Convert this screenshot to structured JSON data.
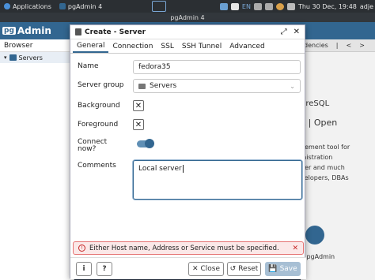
{
  "sysbar": {
    "applications": "Applications",
    "task": "pgAdmin 4",
    "lang": "EN",
    "clock": "Thu 30 Dec, 19:48",
    "user": "adje"
  },
  "window": {
    "title": "pgAdmin 4"
  },
  "app": {
    "logo_pg": "pg",
    "logo_name": "Admin"
  },
  "browser": {
    "header": "Browser",
    "tree_item": "Servers"
  },
  "background": {
    "tabs": [
      "dencies",
      "|",
      "<",
      ">"
    ],
    "lines": [
      "greSQL",
      "L | Open",
      "gement tool for",
      "inistration",
      "ger and much",
      "velopers, DBAs",
      "e pgAdmin"
    ]
  },
  "dialog": {
    "title": "Create - Server",
    "tabs": [
      "General",
      "Connection",
      "SSL",
      "SSH Tunnel",
      "Advanced"
    ],
    "fields": {
      "name_label": "Name",
      "name_value": "fedora35",
      "group_label": "Server group",
      "group_value": "Servers",
      "background_label": "Background",
      "foreground_label": "Foreground",
      "connect_label_1": "Connect",
      "connect_label_2": "now?",
      "comments_label": "Comments",
      "comments_value": "Local server"
    },
    "error": "Either Host name, Address or Service must be specified.",
    "buttons": {
      "info": "i",
      "help": "?",
      "close": "Close",
      "reset": "Reset",
      "save": "Save"
    }
  },
  "colors": {
    "brand": "#326690",
    "error_bg": "#fbe8e8",
    "error_border": "#e57373"
  }
}
